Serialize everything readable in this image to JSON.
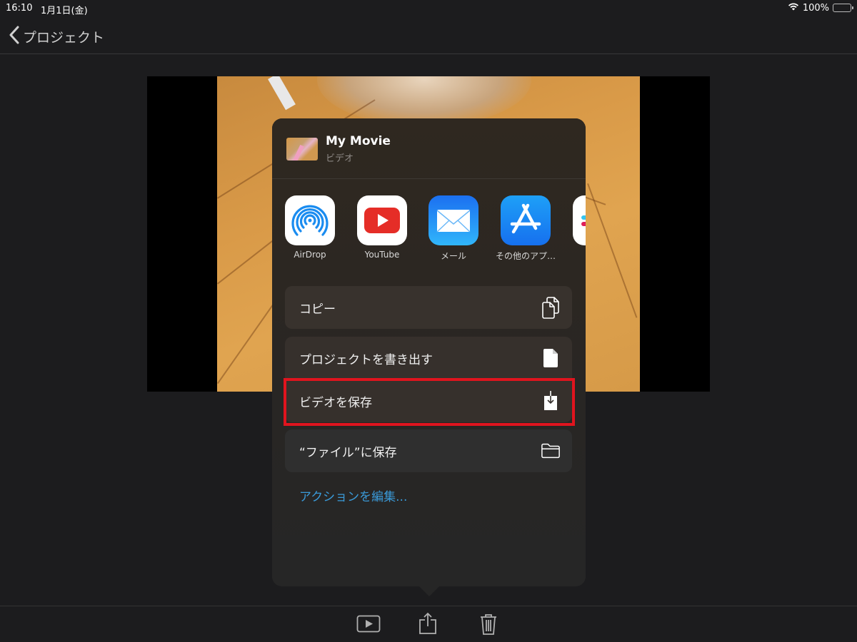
{
  "status_bar": {
    "time": "16:10",
    "date": "1月1日(金)",
    "battery_percent": "100%",
    "wifi_icon": "wifi-icon",
    "battery_icon": "battery-icon",
    "battery_level": 1.0
  },
  "nav": {
    "back_label": "プロジェクト",
    "back_icon": "chevron-left-icon"
  },
  "share_sheet": {
    "title": "My Movie",
    "subtitle": "ビデオ",
    "apps": [
      {
        "label": "AirDrop",
        "icon": "airdrop-icon"
      },
      {
        "label": "YouTube",
        "icon": "youtube-icon"
      },
      {
        "label": "メール",
        "icon": "mail-icon"
      },
      {
        "label": "その他のアプ…",
        "icon": "app-store-icon"
      },
      {
        "label": "",
        "icon": "slack-icon"
      }
    ],
    "actions": [
      {
        "label": "コピー",
        "icon": "copy-icon"
      },
      {
        "label": "プロジェクトを書き出す",
        "icon": "document-icon"
      },
      {
        "label": "ビデオを保存",
        "icon": "save-download-icon",
        "highlighted": true
      },
      {
        "label": "“ファイル”に保存",
        "icon": "folder-icon"
      }
    ],
    "edit_actions_label": "アクションを編集...",
    "highlight_color": "#e0141e",
    "link_color": "#3a9ad8"
  },
  "toolbar": {
    "buttons": [
      {
        "name": "play",
        "icon": "play-icon"
      },
      {
        "name": "share",
        "icon": "share-icon"
      },
      {
        "name": "delete",
        "icon": "trash-icon"
      }
    ]
  }
}
